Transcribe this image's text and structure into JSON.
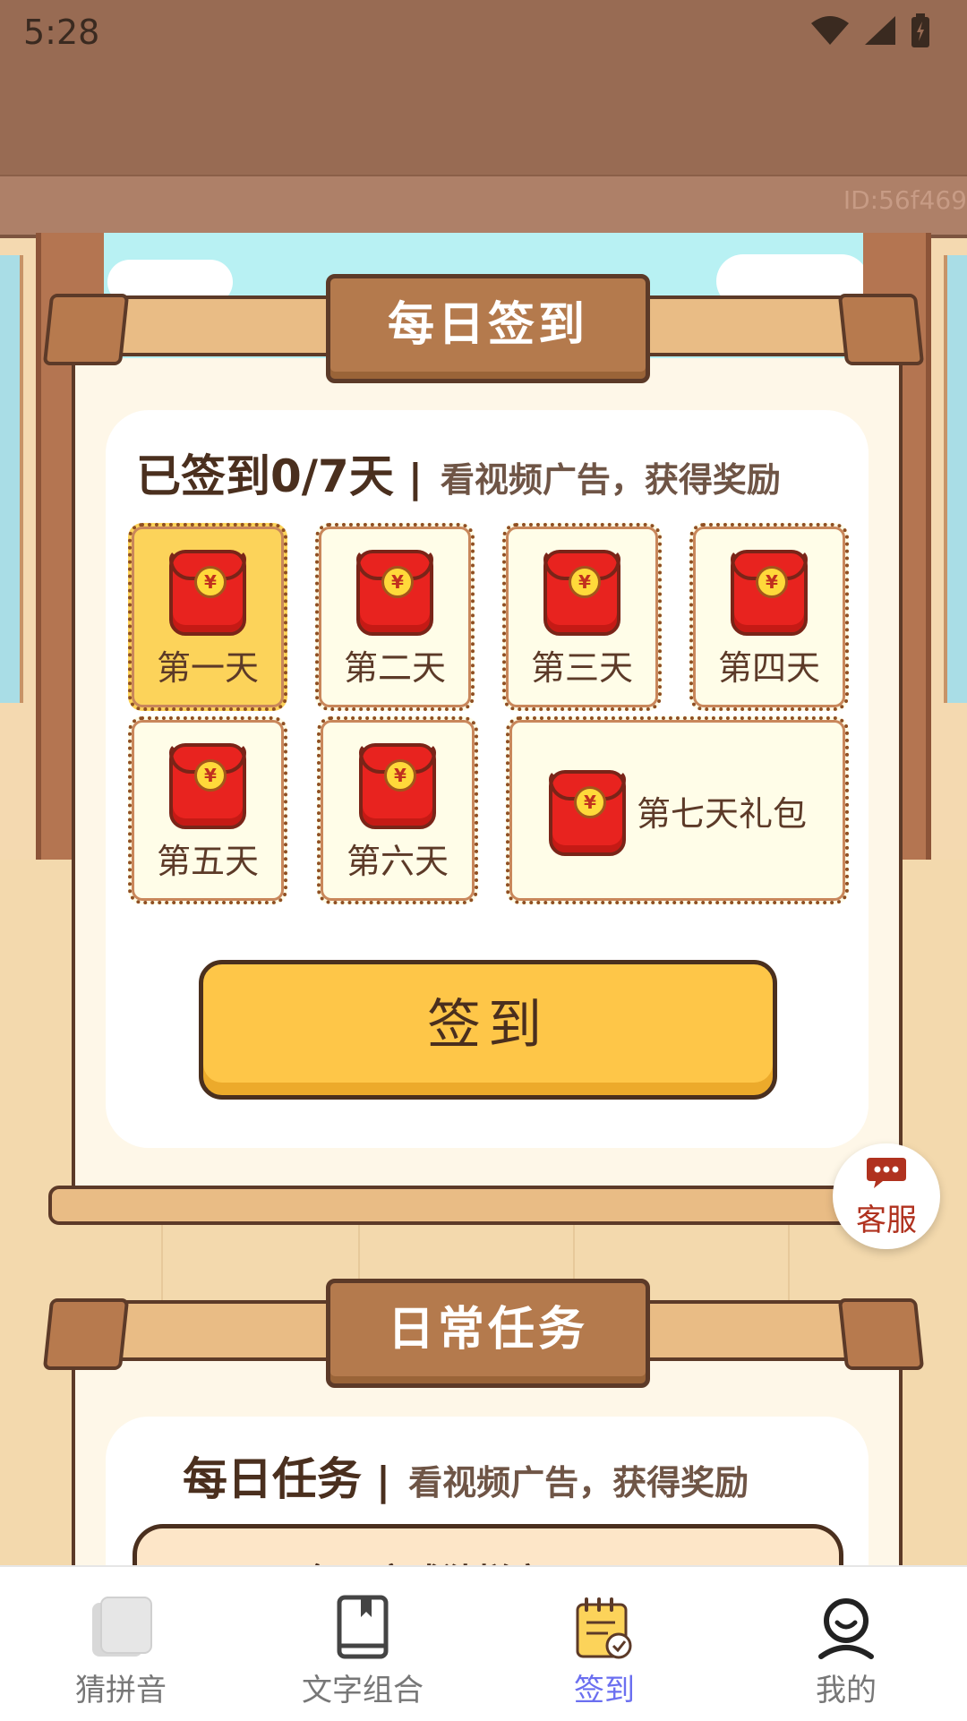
{
  "status_bar": {
    "time": "5:28"
  },
  "id_text": "ID:56f469",
  "daily_signin": {
    "banner_title": "每日签到",
    "progress_text": "已签到0/7天",
    "separator": "|",
    "subtitle": "看视频广告，获得奖励",
    "days": [
      {
        "label": "第一天",
        "active": true
      },
      {
        "label": "第二天",
        "active": false
      },
      {
        "label": "第三天",
        "active": false
      },
      {
        "label": "第四天",
        "active": false
      },
      {
        "label": "第五天",
        "active": false
      },
      {
        "label": "第六天",
        "active": false
      },
      {
        "label": "第七天礼包",
        "active": false
      }
    ],
    "coin_symbol": "¥",
    "button_label": "签到"
  },
  "customer_service": {
    "label": "客服",
    "icon": "chat-bubble-icon"
  },
  "daily_tasks": {
    "banner_title": "日常任务",
    "heading": "每日任务",
    "separator": "|",
    "subtitle": "看视频广告，获得奖励",
    "first_task_title": "每日完成猜拼音"
  },
  "bottom_nav": [
    {
      "label": "猜拼音",
      "icon": "cards-icon",
      "active": false
    },
    {
      "label": "文字组合",
      "icon": "book-icon",
      "active": false
    },
    {
      "label": "签到",
      "icon": "calendar-check-icon",
      "active": true
    },
    {
      "label": "我的",
      "icon": "user-icon",
      "active": false
    }
  ],
  "colors": {
    "wood_dark": "#5c3a28",
    "wood_light": "#e9bc85",
    "button_yellow": "#fec648",
    "active_day": "#fcd35a",
    "envelope_red": "#e8231f",
    "nav_active": "#6b6ff0"
  }
}
